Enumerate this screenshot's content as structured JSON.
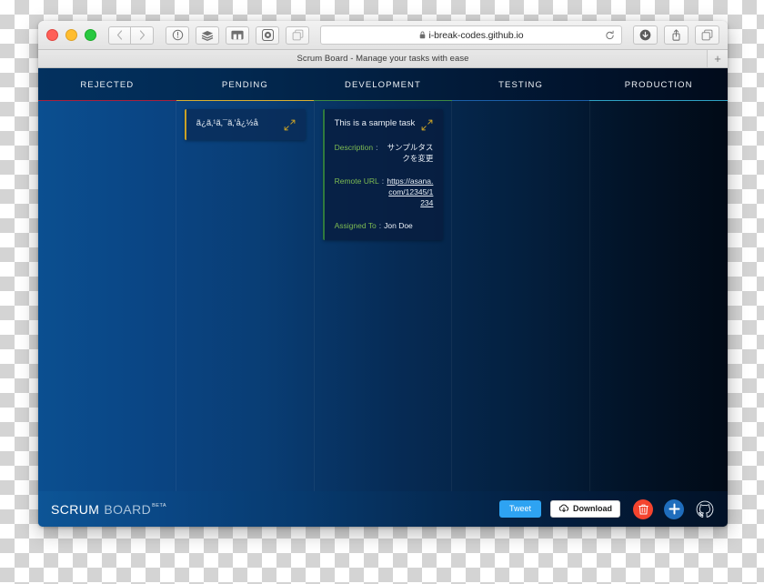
{
  "browser": {
    "address": "i-break-codes.github.io",
    "tab_title": "Scrum Board - Manage your tasks with ease",
    "new_tab_label": "+",
    "traffic_lights": [
      "close",
      "minimize",
      "zoom"
    ],
    "toolbar_icons": [
      "back-icon",
      "forward-icon",
      "reader-icon",
      "layers-icon",
      "sidebar-icon",
      "record-icon",
      "tabs-icon"
    ],
    "right_icons": [
      "download-icon",
      "share-icon",
      "tab-overview-icon"
    ]
  },
  "board": {
    "columns": [
      {
        "label": "REJECTED",
        "accent": "#a8213f"
      },
      {
        "label": "PENDING",
        "accent": "#d8b133"
      },
      {
        "label": "DEVELOPMENT",
        "accent": "#3d8a44"
      },
      {
        "label": "TESTING",
        "accent": "#1b5fa8"
      },
      {
        "label": "PRODUCTION",
        "accent": "#2fa2c4"
      }
    ],
    "cards": {
      "pending": [
        {
          "title": "ã¿ã‚¹ã‚¯ã‚’å¿½å",
          "expand_icon": "expand-icon"
        }
      ],
      "development": [
        {
          "title": "This is a sample task",
          "expand_icon": "expand-icon",
          "fields": [
            {
              "label": "Description",
              "sep": ":",
              "value": "サンプルタスクを変更",
              "type": "text"
            },
            {
              "label": "Remote URL",
              "sep": ":",
              "value": "https://asana.com/12345/1234",
              "type": "link"
            },
            {
              "label": "Assigned To",
              "sep": ":",
              "value": "Jon Doe",
              "type": "inline"
            }
          ]
        }
      ]
    }
  },
  "footer": {
    "brand_primary": "SCRUM",
    "brand_secondary": "BOARD",
    "brand_badge": "BETA",
    "tweet_label": "Tweet",
    "download_label": "Download",
    "download_icon": "cloud-download-icon",
    "delete_icon": "trash-icon",
    "add_icon": "plus-icon",
    "github_icon": "github-icon"
  },
  "colors": {
    "tweet_blue": "#2ea3f2",
    "delete_red": "#f4442e",
    "add_blue": "#1f6dbc",
    "label_green": "#7dbb52",
    "gold": "#c9a227"
  }
}
